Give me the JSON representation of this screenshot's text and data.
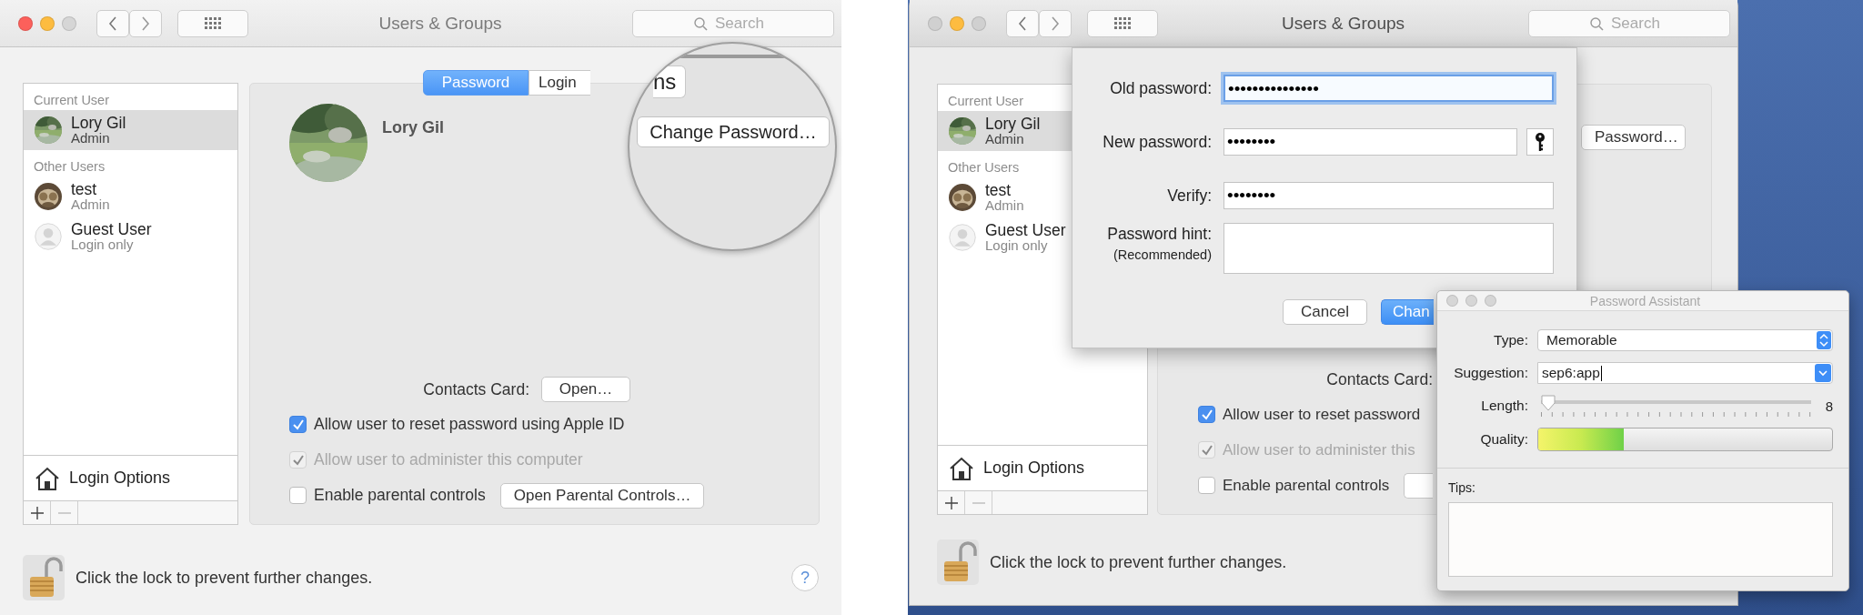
{
  "left_window": {
    "title": "Users & Groups",
    "search": {
      "placeholder": "Search"
    },
    "sidebar": {
      "sections": [
        {
          "header": "Current User",
          "users": [
            {
              "name": "Lory  Gil",
              "role": "Admin",
              "kind": "landscape",
              "selected": true
            }
          ]
        },
        {
          "header": "Other Users",
          "users": [
            {
              "name": "test",
              "role": "Admin",
              "kind": "owl",
              "selected": false
            },
            {
              "name": "Guest User",
              "role": "Login only",
              "kind": "silhouette",
              "selected": false
            }
          ]
        }
      ],
      "login_options": "Login Options"
    },
    "tabs": [
      {
        "label": "Password",
        "selected": true
      },
      {
        "label": "Login",
        "selected": false
      }
    ],
    "user_name": "Lory  Gil",
    "contacts": {
      "label": "Contacts Card:",
      "button": "Open…"
    },
    "options": [
      {
        "label": "Allow user to reset password using Apple ID",
        "checked": true,
        "disabled": false
      },
      {
        "label": "Allow user to administer this computer",
        "checked": true,
        "disabled": true
      },
      {
        "label": "Enable parental controls",
        "checked": false,
        "disabled": false,
        "button": "Open Parental Controls…"
      }
    ],
    "lock_text": "Click the lock to prevent further changes.",
    "help": "?",
    "magnifier": {
      "tab_fragment": "ns",
      "button": "Change Password…"
    }
  },
  "right_window": {
    "title": "Users & Groups",
    "search": {
      "placeholder": "Search"
    },
    "sidebar": {
      "sections": [
        {
          "header": "Current User",
          "users": [
            {
              "name": "Lory  Gil",
              "role": "Admin",
              "kind": "landscape",
              "selected": true
            }
          ]
        },
        {
          "header": "Other Users",
          "users": [
            {
              "name": "test",
              "role": "Admin",
              "kind": "owl",
              "selected": false
            },
            {
              "name": "Guest User",
              "role": "Login only",
              "kind": "silhouette",
              "selected": false
            }
          ]
        }
      ],
      "login_options": "Login Options"
    },
    "password_button": "Password…",
    "contacts_label": "Contacts Card:",
    "options": [
      {
        "label": "Allow user to reset password",
        "checked": true,
        "disabled": false
      },
      {
        "label": "Allow user to administer this",
        "checked": true,
        "disabled": true
      },
      {
        "label": "Enable parental controls",
        "checked": false,
        "disabled": false,
        "button_stub": true
      }
    ],
    "lock_text": "Click the lock to prevent further changes.",
    "sheet": {
      "fields": [
        {
          "label": "Old password:",
          "value": "•••••••••••••••",
          "kind": "password",
          "focused": true
        },
        {
          "label": "New password:",
          "value": "••••••••",
          "kind": "password_key",
          "focused": false
        },
        {
          "label": "Verify:",
          "value": "••••••••",
          "kind": "password",
          "focused": false
        },
        {
          "label": "Password hint:",
          "sublabel": "(Recommended)",
          "kind": "hint",
          "focused": false
        }
      ],
      "buttons": [
        {
          "label": "Cancel",
          "default": false
        },
        {
          "label": "Chan",
          "default": true
        }
      ]
    },
    "assistant": {
      "title": "Password Assistant",
      "type": {
        "label": "Type:",
        "value": "Memorable"
      },
      "suggestion": {
        "label": "Suggestion:",
        "value": "sep6:app"
      },
      "length": {
        "label": "Length:",
        "level": 0,
        "reading": "8"
      },
      "quality": {
        "label": "Quality:",
        "level": 0.29
      },
      "tips_label": "Tips:"
    }
  }
}
